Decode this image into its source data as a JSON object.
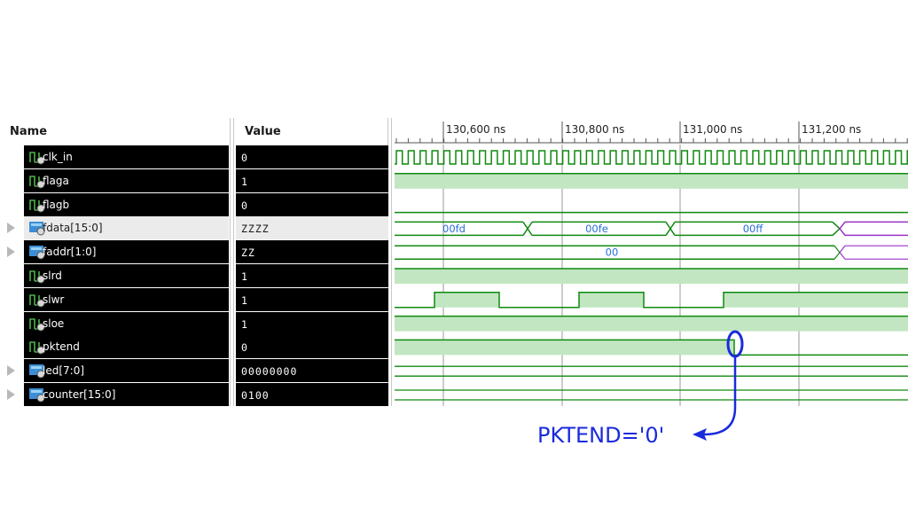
{
  "headers": {
    "name": "Name",
    "value": "Value"
  },
  "ruler_labels": [
    "130,600 ns",
    "130,800 ns",
    "131,000 ns",
    "131,200 ns"
  ],
  "signals": [
    {
      "name": "clk_in",
      "value": "0",
      "kind": "bit",
      "expandable": false
    },
    {
      "name": "flaga",
      "value": "1",
      "kind": "bit",
      "expandable": false
    },
    {
      "name": "flagb",
      "value": "0",
      "kind": "bit",
      "expandable": false
    },
    {
      "name": "fdata[15:0]",
      "value": "ZZZZ",
      "kind": "bus",
      "expandable": true,
      "selected": true
    },
    {
      "name": "faddr[1:0]",
      "value": "ZZ",
      "kind": "bus",
      "expandable": true
    },
    {
      "name": "slrd",
      "value": "1",
      "kind": "bit",
      "expandable": false
    },
    {
      "name": "slwr",
      "value": "1",
      "kind": "bit",
      "expandable": false
    },
    {
      "name": "sloe",
      "value": "1",
      "kind": "bit",
      "expandable": false
    },
    {
      "name": "pktend",
      "value": "0",
      "kind": "bit",
      "expandable": false
    },
    {
      "name": "led[7:0]",
      "value": "00000000",
      "kind": "bus",
      "expandable": true
    },
    {
      "name": "counter[15:0]",
      "value": "0100",
      "kind": "bus",
      "expandable": true
    }
  ],
  "bus_labels": {
    "fdata": [
      "00fd",
      "00fe",
      "00ff"
    ],
    "faddr": [
      "00"
    ]
  },
  "annotation": {
    "text": "PKTEND='0'"
  },
  "colors": {
    "wave_green": "#0f8a0f",
    "wave_fill": "#c2e6c2",
    "bus_text": "#2a6fd6",
    "purple": "#9b32c8",
    "annotation_blue": "#1a2bdb",
    "cursor_gray": "#9a9a9a"
  }
}
